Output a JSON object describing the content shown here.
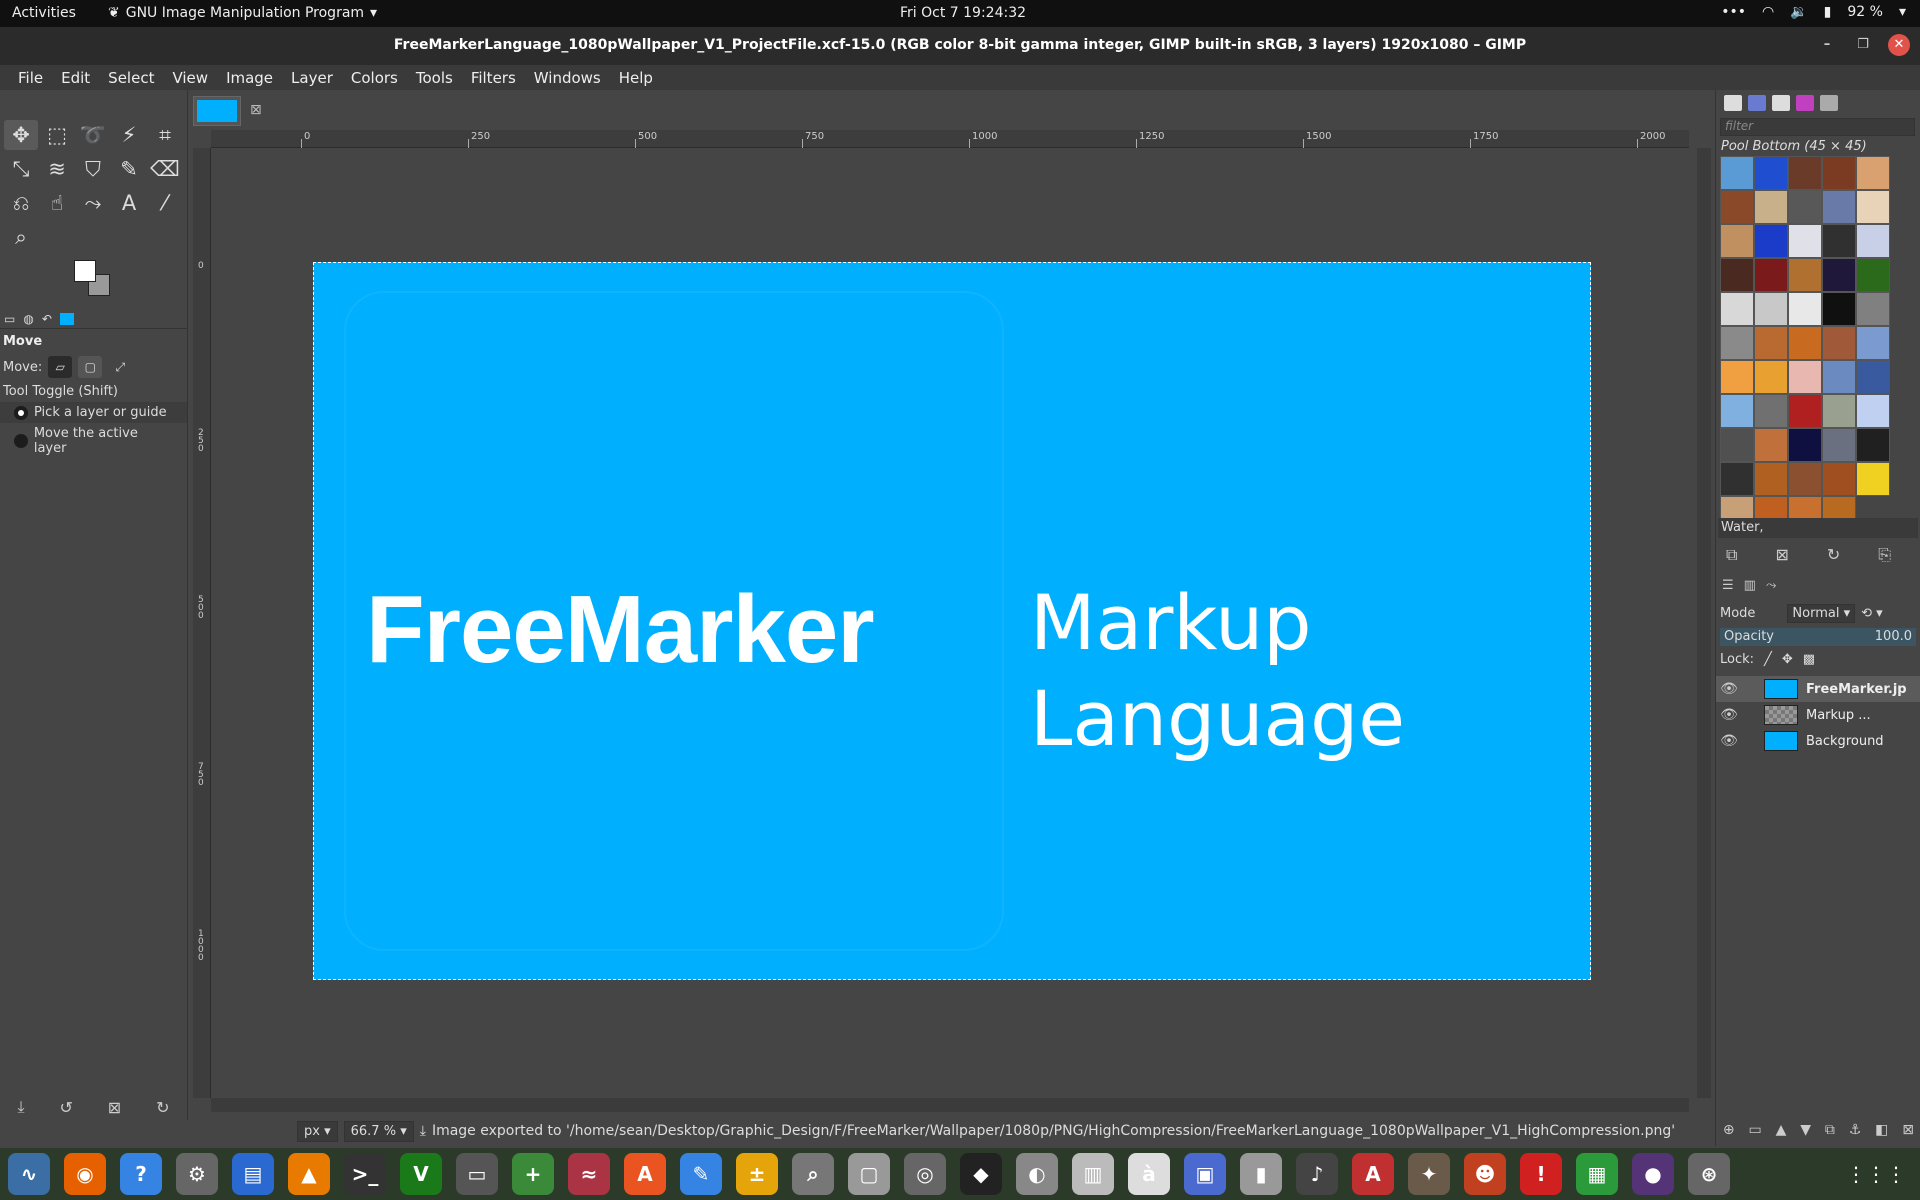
{
  "topbar": {
    "activities": "Activities",
    "app_name": "GNU Image Manipulation Program",
    "clock": "Fri Oct 7  19:24:32",
    "battery": "92 %"
  },
  "window": {
    "title": "FreeMarkerLanguage_1080pWallpaper_V1_ProjectFile.xcf-15.0 (RGB color 8-bit gamma integer, GIMP built-in sRGB, 3 layers) 1920x1080 – GIMP"
  },
  "menu": [
    "File",
    "Edit",
    "Select",
    "View",
    "Image",
    "Layer",
    "Colors",
    "Tools",
    "Filters",
    "Windows",
    "Help"
  ],
  "toolbox": {
    "tools": [
      {
        "name": "move-tool-icon",
        "glyph": "✥"
      },
      {
        "name": "rect-select-icon",
        "glyph": "⬚"
      },
      {
        "name": "free-select-icon",
        "glyph": "➰"
      },
      {
        "name": "fuzzy-select-icon",
        "glyph": "⚡"
      },
      {
        "name": "crop-icon",
        "glyph": "⌗"
      },
      {
        "name": "transform-icon",
        "glyph": "⤡"
      },
      {
        "name": "warp-icon",
        "glyph": "≋"
      },
      {
        "name": "bucket-fill-icon",
        "glyph": "⛉"
      },
      {
        "name": "paintbrush-icon",
        "glyph": "✎"
      },
      {
        "name": "eraser-icon",
        "glyph": "⌫"
      },
      {
        "name": "clone-icon",
        "glyph": "⎌"
      },
      {
        "name": "smudge-icon",
        "glyph": "☝"
      },
      {
        "name": "paths-icon",
        "glyph": "⤳"
      },
      {
        "name": "text-icon",
        "glyph": "A"
      },
      {
        "name": "color-picker-icon",
        "glyph": "⁄"
      },
      {
        "name": "zoom-icon",
        "glyph": "⌕"
      }
    ],
    "options": {
      "heading": "Move",
      "move_label": "Move:",
      "toggle_label": "Tool Toggle  (Shift)",
      "option1": "Pick a layer or guide",
      "option2": "Move the active layer"
    }
  },
  "rulers": {
    "h_ticks": [
      "0",
      "250",
      "500",
      "750",
      "1000",
      "1250",
      "1500",
      "1750",
      "2000"
    ],
    "v_ticks": [
      "0",
      "250",
      "500",
      "750",
      "1000"
    ]
  },
  "artwork": {
    "background_color": "#00b0ff",
    "brand": "FreeMarker",
    "line1": "Markup",
    "line2": "Language"
  },
  "status": {
    "unit": "px",
    "zoom": "66.7 %",
    "message": "Image exported to '/home/sean/Desktop/Graphic_Design/F/FreeMarker/Wallpaper/1080p/PNG/HighCompression/FreeMarkerLanguage_1080pWallpaper_V1_HighCompression.png'"
  },
  "patterns": {
    "filter_placeholder": "filter",
    "title": "Pool Bottom (45 × 45)",
    "selected_name": "Water,",
    "swatches": [
      "#5a9bd6",
      "#1f4fd0",
      "#6b3b2a",
      "#7a3b22",
      "#d9a070",
      "#8a4a2a",
      "#c7b08a",
      "#585858",
      "#6a7aa8",
      "#e8d2b8",
      "#c09060",
      "#1a3cc8",
      "#e0e0e8",
      "#303030",
      "#c8d0e8",
      "#4a2a20",
      "#7a1a1a",
      "#b07030",
      "#20183a",
      "#2a6a1a",
      "#d8d8d8",
      "#c8c8c8",
      "#e8e8e8",
      "#101010",
      "#808080",
      "#8a8a8a",
      "#b86a30",
      "#c86a20",
      "#a05a3a",
      "#7a9ad0",
      "#f0a040",
      "#e8a030",
      "#e8b8b0",
      "#6a8ac0",
      "#3a5aa0",
      "#80b0e0",
      "#707070",
      "#b02020",
      "#9aa090",
      "#c0d0f0",
      "#505050",
      "#c0703a",
      "#101040",
      "#6a7080",
      "#202020",
      "#303030",
      "#b06020",
      "#8a5030",
      "#a05020",
      "#f0d020",
      "#c8a078",
      "#c06020",
      "#c87030",
      "#b86a20"
    ]
  },
  "layers": {
    "mode_label": "Mode",
    "mode_value": "Normal",
    "opacity_label": "Opacity",
    "opacity_value": "100.0",
    "lock_label": "Lock:",
    "items": [
      {
        "name": "FreeMarker.jp",
        "thumb": "#00b0ff"
      },
      {
        "name": "Markup ...",
        "thumb": "#888888"
      },
      {
        "name": "Background",
        "thumb": "#00b0ff"
      }
    ]
  },
  "dock": {
    "apps": [
      {
        "name": "system-monitor-icon",
        "color": "#3a6ea5",
        "glyph": "∿"
      },
      {
        "name": "firefox-icon",
        "color": "#e66000",
        "glyph": "◉"
      },
      {
        "name": "help-icon",
        "color": "#3584e4",
        "glyph": "?"
      },
      {
        "name": "settings-icon",
        "color": "#666666",
        "glyph": "⚙"
      },
      {
        "name": "writer-icon",
        "color": "#2a6ad0",
        "glyph": "▤"
      },
      {
        "name": "vlc-icon",
        "color": "#e87a00",
        "glyph": "▲"
      },
      {
        "name": "terminal-icon",
        "color": "#333333",
        "glyph": ">_"
      },
      {
        "name": "vim-icon",
        "color": "#1a7a1a",
        "glyph": "V"
      },
      {
        "name": "remote-icon",
        "color": "#555555",
        "glyph": "▭"
      },
      {
        "name": "plus-app-icon",
        "color": "#3a8a3a",
        "glyph": "+"
      },
      {
        "name": "audio-editor-icon",
        "color": "#aa3344",
        "glyph": "≈"
      },
      {
        "name": "software-center-icon",
        "color": "#e95420",
        "glyph": "A"
      },
      {
        "name": "text-editor-icon",
        "color": "#3584e4",
        "glyph": "✎"
      },
      {
        "name": "calculator-icon",
        "color": "#e5a50a",
        "glyph": "±"
      },
      {
        "name": "search-app-icon",
        "color": "#777777",
        "glyph": "⌕"
      },
      {
        "name": "files-icon",
        "color": "#999999",
        "glyph": "▢"
      },
      {
        "name": "disk-icon",
        "color": "#666666",
        "glyph": "◎"
      },
      {
        "name": "inkscape-icon",
        "color": "#222222",
        "glyph": "◆"
      },
      {
        "name": "viewer-icon",
        "color": "#888888",
        "glyph": "◐"
      },
      {
        "name": "document-icon",
        "color": "#bbbbbb",
        "glyph": "▥"
      },
      {
        "name": "character-map-icon",
        "color": "#dddddd",
        "glyph": "à"
      },
      {
        "name": "screen-icon",
        "color": "#4a6ad0",
        "glyph": "▣"
      },
      {
        "name": "archive-icon",
        "color": "#999999",
        "glyph": "▮"
      },
      {
        "name": "music-icon",
        "color": "#444444",
        "glyph": "♪"
      },
      {
        "name": "pdf-icon",
        "color": "#c03030",
        "glyph": "A"
      },
      {
        "name": "gimp-icon",
        "color": "#6a5a4a",
        "glyph": "✦"
      },
      {
        "name": "game-icon",
        "color": "#c04020",
        "glyph": "☻"
      },
      {
        "name": "alert-icon",
        "color": "#d02020",
        "glyph": "!"
      },
      {
        "name": "spreadsheet-icon",
        "color": "#2a9a3a",
        "glyph": "▦"
      },
      {
        "name": "obs-icon",
        "color": "#553377",
        "glyph": "●"
      },
      {
        "name": "updater-icon",
        "color": "#666666",
        "glyph": "⊛"
      }
    ],
    "grid_glyph": "⋮⋮⋮"
  }
}
